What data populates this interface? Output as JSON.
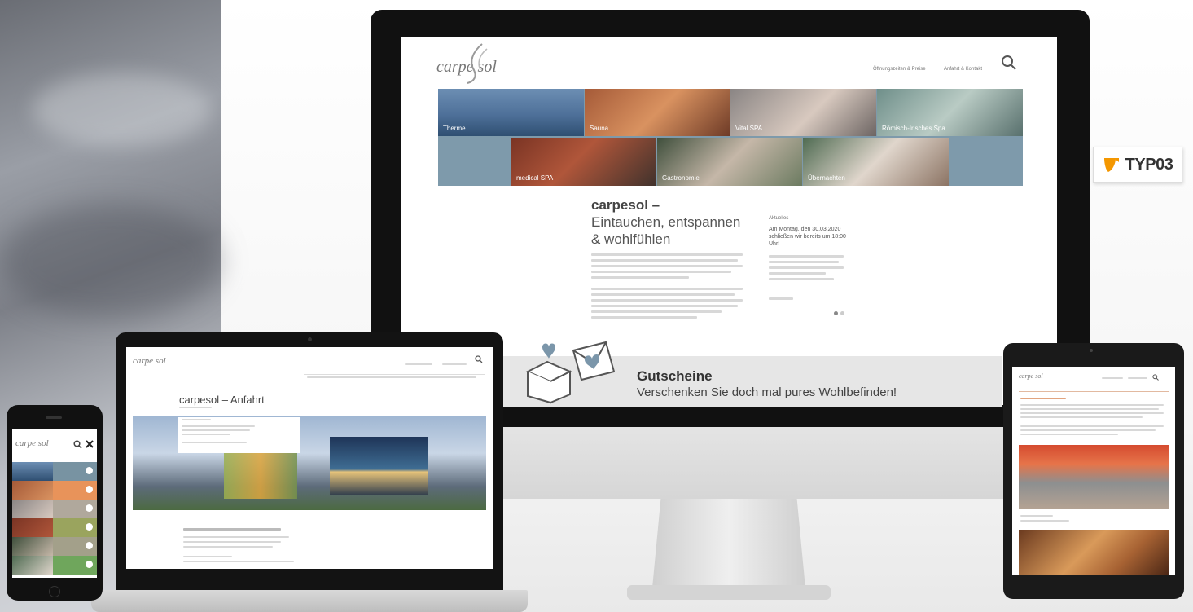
{
  "brand": {
    "logo_text": "carpe sol"
  },
  "desktop": {
    "nav": [
      "Öffnungszeiten & Preise",
      "Anfahrt & Kontakt"
    ],
    "tiles_row1": [
      "Therme",
      "Sauna",
      "Vital SPA",
      "Römisch-Irisches Spa"
    ],
    "tiles_row2": [
      "medical SPA",
      "Gastronomie",
      "Übernachten"
    ],
    "headline_1": "carpesol –",
    "headline_2": "Eintauchen, entspannen",
    "headline_3": "& wohlfühlen",
    "news_label": "Aktuelles",
    "news_text": "Am Montag, den 30.03.2020 schließen wir bereits um 18:00 Uhr!",
    "voucher_title": "Gutscheine",
    "voucher_sub": "Verschenken Sie doch mal pures Wohlbefinden!"
  },
  "badge": {
    "typo3": "TYP03",
    "color": "#f49700"
  },
  "laptop": {
    "page_title": "carpesol – Anfahrt"
  },
  "colors": {
    "slate": "#7893a2",
    "orange": "#e8935a",
    "olive": "#9aa45e",
    "green": "#6fa65c"
  },
  "icons": [
    "search-icon",
    "close-icon",
    "heart-box-icon",
    "chevron-icon"
  ]
}
